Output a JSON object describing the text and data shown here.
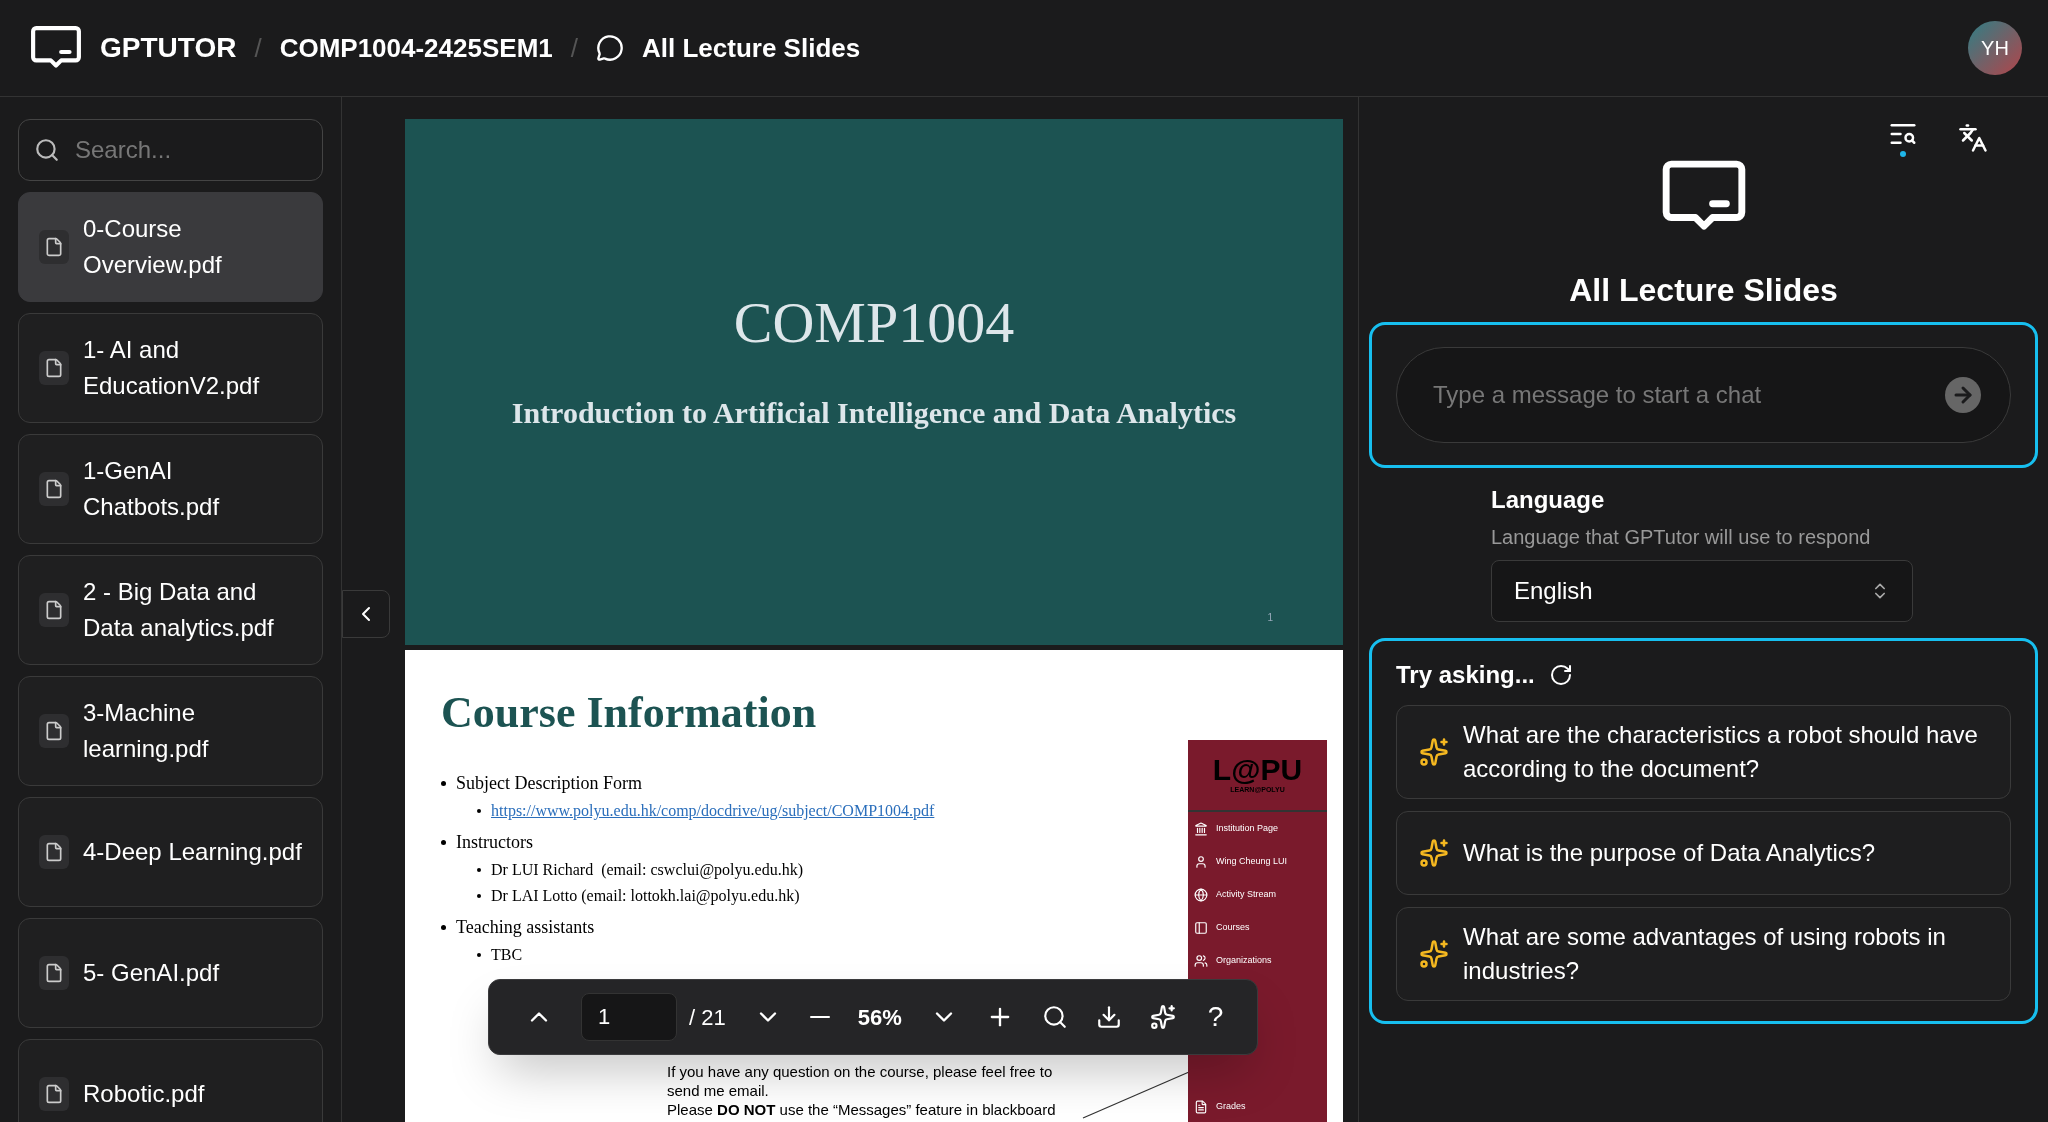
{
  "header": {
    "brand": "GPTUTOR",
    "separator": "/",
    "course": "COMP1004-2425SEM1",
    "page": "All Lecture Slides",
    "avatar": "YH"
  },
  "sidebar": {
    "search": {
      "placeholder": "Search..."
    },
    "files": [
      {
        "name": "0-Course Overview.pdf",
        "selected": true
      },
      {
        "name": "1- AI and EducationV2.pdf",
        "selected": false
      },
      {
        "name": "1-GenAI Chatbots.pdf",
        "selected": false
      },
      {
        "name": "2 - Big Data and Data analytics.pdf",
        "selected": false
      },
      {
        "name": "3-Machine learning.pdf",
        "selected": false
      },
      {
        "name": "4-Deep Learning.pdf",
        "selected": false
      },
      {
        "name": "5- GenAI.pdf",
        "selected": false
      },
      {
        "name": "Robotic.pdf",
        "selected": false
      }
    ]
  },
  "viewer": {
    "title_slide": {
      "title": "COMP1004",
      "subtitle": "Introduction to Artificial Intelligence and Data Analytics",
      "page_number": "1"
    },
    "info_slide": {
      "title": "Course Information",
      "bullets": [
        {
          "text": "Subject Description Form",
          "children": [
            {
              "text": "https://www.polyu.edu.hk/comp/docdrive/ug/subject/COMP1004.pdf",
              "kind": "link"
            }
          ]
        },
        {
          "text": "Instructors",
          "children": [
            {
              "text": "Dr LUI Richard  (email: cswclui@polyu.edu.hk)",
              "kind": "text"
            },
            {
              "text": "Dr LAI Lotto (email: lottokh.lai@polyu.edu.hk)",
              "kind": "text"
            }
          ]
        },
        {
          "text": "Teaching assistants",
          "children": [
            {
              "text": "TBC",
              "kind": "text"
            }
          ]
        }
      ],
      "note": [
        "If you have any question on the course, please feel free to",
        "send me email.",
        "Please **DO NOT** use the “Messages” feature in blackboard"
      ],
      "lms": {
        "logo": "L@PU",
        "logo_subtitle": "LEARN@POLYU",
        "items": [
          {
            "label": "Institution Page",
            "kind": "institution"
          },
          {
            "label": "Wing Cheung LUI",
            "kind": "user"
          },
          {
            "label": "Activity Stream",
            "kind": "globe"
          },
          {
            "label": "Courses",
            "kind": "courses"
          },
          {
            "label": "Organizations",
            "kind": "organizations"
          },
          {
            "label": "Grades",
            "kind": "grades"
          }
        ]
      }
    },
    "toolbar": {
      "page": "1",
      "total": "/ 21",
      "zoom": "56%",
      "help": "?"
    }
  },
  "chat": {
    "title": "All Lecture Slides",
    "input": {
      "placeholder": "Type a message to start a chat"
    },
    "language": {
      "label": "Language",
      "description": "Language that GPTutor will use to respond",
      "value": "English"
    },
    "suggestions": {
      "title": "Try asking...",
      "questions": [
        "What are the characteristics a robot should have according to the document?",
        "What is the purpose of Data Analytics?",
        "What are some advantages of using robots in industries?"
      ]
    }
  }
}
